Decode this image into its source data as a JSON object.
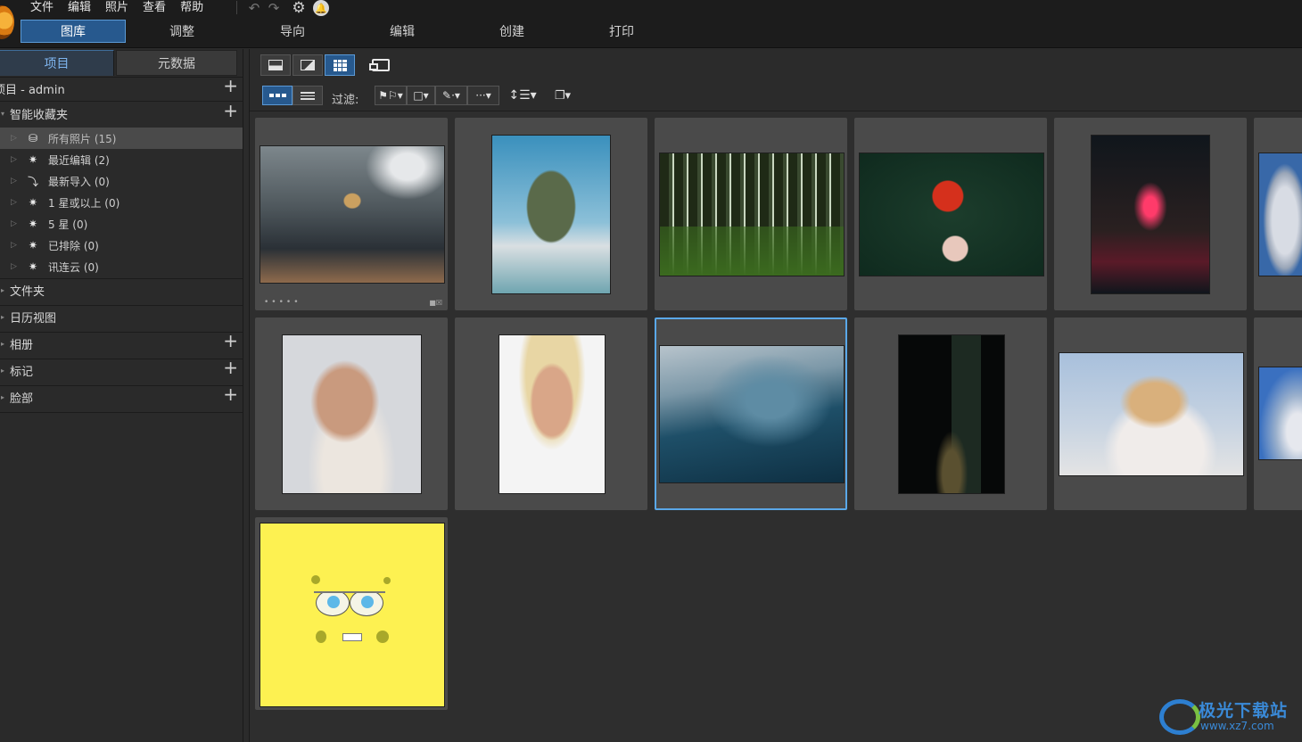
{
  "menu": {
    "items": [
      "文件",
      "编辑",
      "照片",
      "查看",
      "帮助"
    ]
  },
  "modules": {
    "tabs": [
      "图库",
      "调整",
      "导向",
      "编辑",
      "创建",
      "打印"
    ],
    "active": 0
  },
  "left_panel": {
    "tabs": [
      "项目",
      "元数据"
    ],
    "project_row": "项目 - admin",
    "smart_collections": "智能收藏夹",
    "smart_items": [
      {
        "label": "所有照片 (15)",
        "icon": "network-icon"
      },
      {
        "label": "最近编辑 (2)",
        "icon": "sparkle-icon"
      },
      {
        "label": "最新导入 (0)",
        "icon": "import-icon"
      },
      {
        "label": "1 星或以上 (0)",
        "icon": "sparkle-icon"
      },
      {
        "label": "5 星 (0)",
        "icon": "sparkle-icon"
      },
      {
        "label": "已排除 (0)",
        "icon": "sparkle-icon"
      },
      {
        "label": "讯连云 (0)",
        "icon": "sparkle-icon"
      }
    ],
    "sections": [
      {
        "label": "文件夹",
        "plus": false
      },
      {
        "label": "日历视图",
        "plus": false
      },
      {
        "label": "相册",
        "plus": true
      },
      {
        "label": "标记",
        "plus": true
      },
      {
        "label": "脸部",
        "plus": true
      }
    ]
  },
  "toolbar": {
    "filter_label": "过滤:"
  },
  "thumbnails": [
    {
      "subject": "basketball-dunk",
      "colors": [
        "#2a3036",
        "#6e767a",
        "#caa060"
      ]
    },
    {
      "subject": "rock-island-boat",
      "colors": [
        "#3a90bd",
        "#5a6a4a",
        "#d9dfe2"
      ]
    },
    {
      "subject": "forest",
      "colors": [
        "#1f2a16",
        "#3b6a1f",
        "#c9d7c0"
      ]
    },
    {
      "subject": "red-maple-leaf",
      "colors": [
        "#0f2a1e",
        "#1c3d2c",
        "#d5301c"
      ]
    },
    {
      "subject": "neon-crepe-shop",
      "colors": [
        "#10161c",
        "#2a2020",
        "#ff3b6a"
      ]
    },
    {
      "subject": "cloud-partial",
      "colors": [
        "#3868a8",
        "#9aa6b8",
        "#d8dce4"
      ]
    },
    {
      "subject": "smiling-woman",
      "colors": [
        "#d6d8dc",
        "#c99a7e",
        "#ece6df"
      ]
    },
    {
      "subject": "laughing-woman",
      "colors": [
        "#f4f4f4",
        "#d9a688",
        "#e8d6a4"
      ]
    },
    {
      "subject": "ocean-wave",
      "colors": [
        "#b8c4cc",
        "#1e4f68",
        "#0e2f42"
      ]
    },
    {
      "subject": "dark-window",
      "colors": [
        "#060808",
        "#1d2a22",
        "#b8b070"
      ]
    },
    {
      "subject": "blonde-woman-outdoors",
      "colors": [
        "#a8c0dc",
        "#d9b07c",
        "#f0ecea"
      ]
    },
    {
      "subject": "globe-partial",
      "colors": [
        "#3a70c0",
        "#9ab0cc",
        "#e6e8ee"
      ]
    },
    {
      "subject": "spongebob-face",
      "colors": [
        "#fdf151",
        "#a8a82a",
        "#5cb8e8"
      ]
    }
  ],
  "watermark": {
    "title": "极光下载站",
    "url": "www.xz7.com"
  }
}
